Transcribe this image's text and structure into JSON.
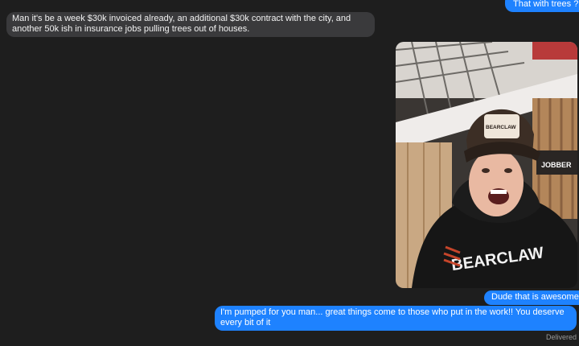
{
  "messages": {
    "top_sent": "That with trees ?",
    "received_1": "Man it's be a week $30k invoiced already, an additional $30k contract with the city, and another 50k ish in insurance jobs pulling trees out of houses.",
    "sent_1": "Dude that is awesome",
    "sent_2": "I'm pumped for you man... great things come to those who put in the work!! You deserve every bit of it"
  },
  "photo": {
    "hat_text": "BEARCLAW",
    "hoodie_text": "BEARCLAW",
    "sign_text": "JOBBER"
  },
  "status": {
    "delivered": "Delivered"
  },
  "colors": {
    "background": "#1e1e1e",
    "incoming_bubble": "#3a3a3c",
    "outgoing_bubble": "#1e82ff"
  }
}
